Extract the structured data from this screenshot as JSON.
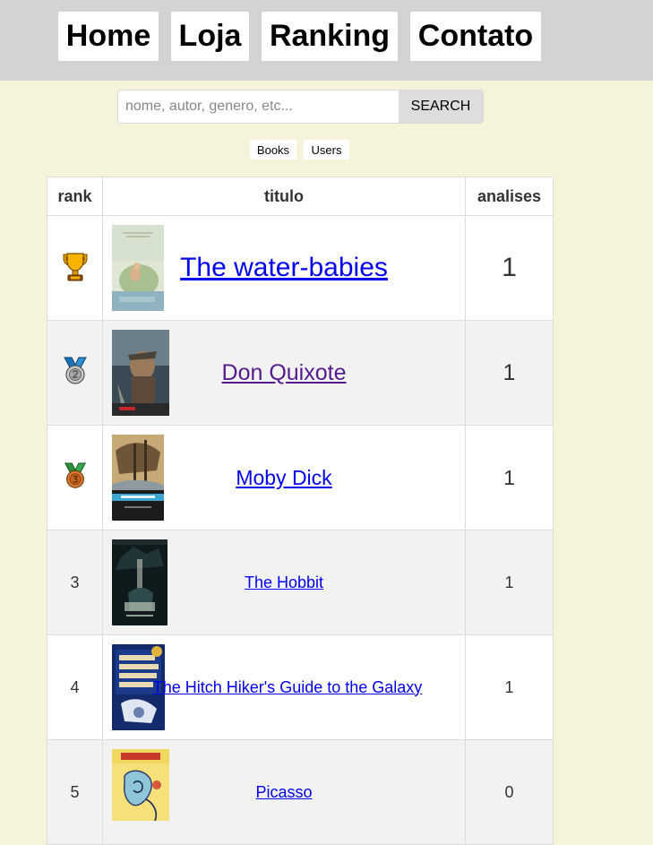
{
  "nav": {
    "items": [
      {
        "label": "Home"
      },
      {
        "label": "Loja"
      },
      {
        "label": "Ranking"
      },
      {
        "label": "Contato"
      }
    ]
  },
  "search": {
    "placeholder": "nome, autor, genero, etc...",
    "value": "",
    "button_label": "SEARCH"
  },
  "filters": [
    {
      "label": "Books"
    },
    {
      "label": "Users"
    }
  ],
  "table": {
    "headers": {
      "rank": "rank",
      "title": "titulo",
      "reviews": "analises"
    },
    "rows": [
      {
        "rank": "",
        "rank_icon": "trophy-icon",
        "title": "The water-babies",
        "reviews": "1",
        "link_color": "#0000ee",
        "cover_icon": "water-babies-cover"
      },
      {
        "rank": "",
        "rank_icon": "silver-medal-icon",
        "title": "Don Quixote",
        "reviews": "1",
        "link_color": "#551a8b",
        "cover_icon": "don-quixote-cover"
      },
      {
        "rank": "",
        "rank_icon": "bronze-medal-icon",
        "title": "Moby Dick",
        "reviews": "1",
        "link_color": "#0000ee",
        "cover_icon": "moby-dick-cover"
      },
      {
        "rank": "3",
        "rank_icon": "",
        "title": "The Hobbit",
        "reviews": "1",
        "link_color": "#0000ee",
        "cover_icon": "hobbit-cover"
      },
      {
        "rank": "4",
        "rank_icon": "",
        "title": "The Hitch Hiker's Guide to the Galaxy",
        "reviews": "1",
        "link_color": "#0000ee",
        "cover_icon": "hitchhiker-cover"
      },
      {
        "rank": "5",
        "rank_icon": "",
        "title": "Picasso",
        "reviews": "0",
        "link_color": "#0000ee",
        "cover_icon": "picasso-cover"
      }
    ]
  },
  "colors": {
    "page_bg": "#f5f4da",
    "nav_bg": "#d3d3d3",
    "link": "#0000ee",
    "visited_link": "#551a8b"
  }
}
